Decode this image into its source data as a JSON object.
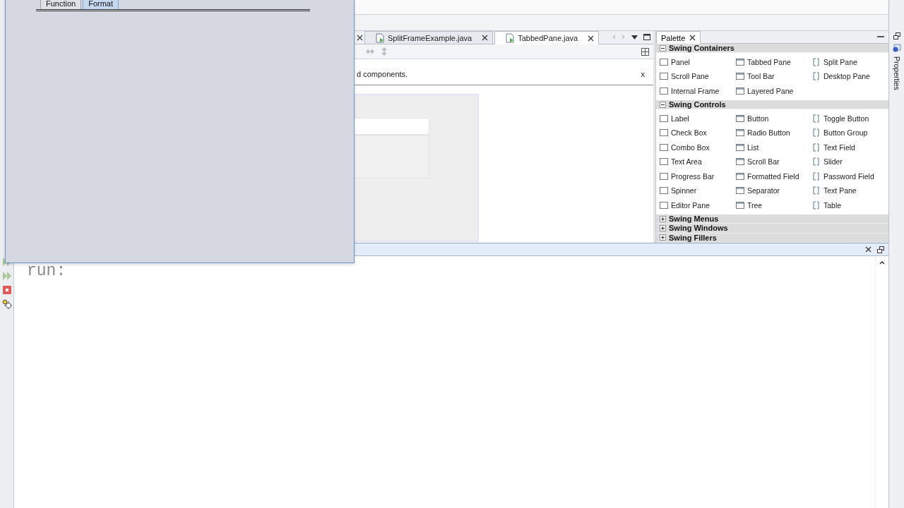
{
  "floating_window": {
    "tabs": [
      {
        "label": "Function",
        "selected": false
      },
      {
        "label": "Format",
        "selected": true
      }
    ]
  },
  "editor": {
    "tabs": [
      {
        "label": "SplitFrameExample.java",
        "selected": false
      },
      {
        "label": "TabbedPane.java",
        "selected": true
      }
    ],
    "info_bar": {
      "text": "d components.",
      "close": "x"
    }
  },
  "palette": {
    "title": "Palette",
    "categories": [
      {
        "label": "Swing Containers",
        "expanded": true,
        "items": [
          "Panel",
          "Tabbed Pane",
          "Split Pane",
          "Scroll Pane",
          "Tool Bar",
          "Desktop Pane",
          "Internal Frame",
          "Layered Pane"
        ]
      },
      {
        "label": "Swing Controls",
        "expanded": true,
        "items": [
          "Label",
          "Button",
          "Toggle Button",
          "Check Box",
          "Radio Button",
          "Button Group",
          "Combo Box",
          "List",
          "Text Field",
          "Text Area",
          "Scroll Bar",
          "Slider",
          "Progress Bar",
          "Formatted Field",
          "Password Field",
          "Spinner",
          "Separator",
          "Text Pane",
          "Editor Pane",
          "Tree",
          "Table"
        ]
      },
      {
        "label": "Swing Menus",
        "expanded": false
      },
      {
        "label": "Swing Windows",
        "expanded": false
      },
      {
        "label": "Swing Fillers",
        "expanded": false
      }
    ]
  },
  "side_tab": {
    "label": "Properties"
  },
  "output": {
    "lines": [
      "run:"
    ]
  }
}
